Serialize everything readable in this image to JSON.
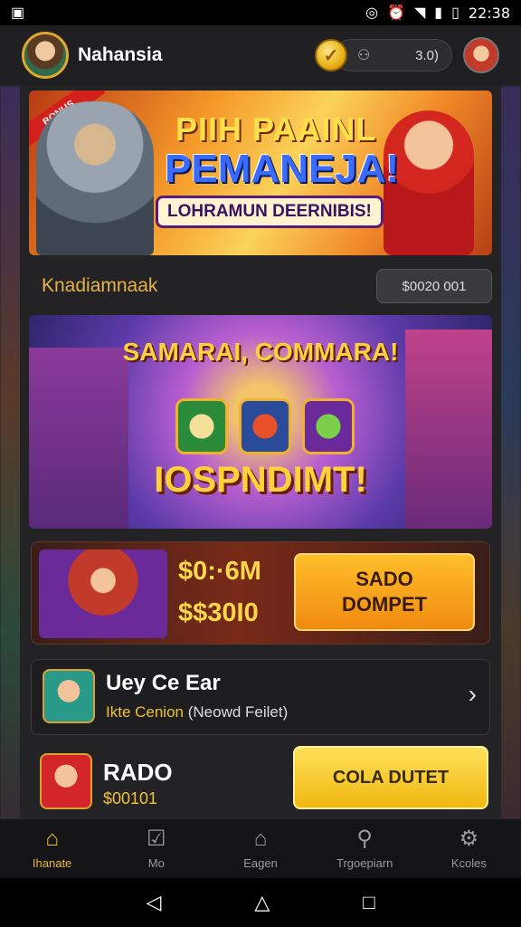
{
  "status_bar": {
    "time": "22:38",
    "icons": [
      "image-icon",
      "nfc-icon",
      "alarm-icon",
      "wifi-icon",
      "signal-icon",
      "battery-icon"
    ]
  },
  "header": {
    "title": "Nahansia",
    "balance": "3.0)",
    "coin_glyph": "✓"
  },
  "banner1": {
    "ribbon": "BONUS",
    "line1": "PIIH PAAINL",
    "line2": "PEMANEJA!",
    "subtitle": "LOHRAMUN DEERNIBIS!"
  },
  "section": {
    "title": "Knadiamnaak",
    "value": "$0020 001"
  },
  "banner2": {
    "title": "SAMARAI, COMMARA!",
    "big_text": "IOSPNDIMT!"
  },
  "promo_card": {
    "amount1": "$0:·6M",
    "amount2": "$$30I0",
    "button": "SADO DOMPET"
  },
  "list_item": {
    "title": "Uey Ce Ear",
    "subtitle_highlight": "Ikte Cenion",
    "subtitle_rest": "(Neowd Feilet)"
  },
  "last_card": {
    "title": "RADO",
    "subtitle": "$00101",
    "button": "COLA DUTET"
  },
  "bottom_nav": [
    {
      "label": "Ihanate",
      "icon": "home-icon",
      "active": true
    },
    {
      "label": "Mo",
      "icon": "checkbox-icon",
      "active": false
    },
    {
      "label": "Eagen",
      "icon": "bank-icon",
      "active": false
    },
    {
      "label": "Trgoepiarn",
      "icon": "search-icon",
      "active": false
    },
    {
      "label": "Kcoles",
      "icon": "network-icon",
      "active": false
    }
  ],
  "colors": {
    "accent": "#f0b830",
    "background": "#1a1a1c",
    "panel": "#232326"
  }
}
